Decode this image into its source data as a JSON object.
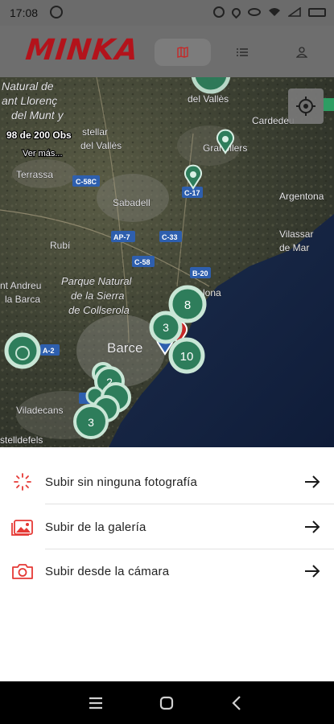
{
  "status_bar": {
    "time": "17:08",
    "icons": [
      "whatsapp-icon",
      "alarm-icon",
      "location-icon",
      "eye-icon",
      "wifi-icon",
      "signal-icon",
      "battery-icon"
    ]
  },
  "header": {
    "logo": "MINKA",
    "tabs": [
      {
        "icon": "map-icon",
        "active": true
      },
      {
        "icon": "list-icon",
        "active": false
      },
      {
        "icon": "profile-icon",
        "active": false
      }
    ]
  },
  "map": {
    "observations_count": "98 de 200 Obs",
    "see_more": "Ver más...",
    "labels": {
      "natural_park_title_1": "Natural de",
      "natural_park_title_2": "ant Llorenç",
      "natural_park_title_3": "del Munt y",
      "del_valles": "del Vallès",
      "cardedeu": "Cardedeu",
      "stellar": "stellar",
      "del_valles_2": "del Vallès",
      "granollers": "Granollers",
      "terrassa": "Terrassa",
      "sabadell": "Sabadell",
      "argentona": "Argentona",
      "vilassar": "Vilassar",
      "de_mar": "de Mar",
      "rubi": "Rubí",
      "collserola_1": "Parque Natural",
      "collserola_2": "de la Sierra",
      "collserola_3": "de Collserola",
      "andreu_1": "nt Andreu",
      "andreu_2": "la Barca",
      "badalona": "lona",
      "barcelona": "Barce",
      "viladecans": "Viladecans",
      "castelldefels": "stelldefels"
    },
    "roads": [
      "C-58C",
      "C-17",
      "AP-7",
      "C-33",
      "C-58",
      "B-20",
      "A-2",
      "C-32"
    ],
    "clusters": [
      "8",
      "3",
      "10",
      "2",
      "3"
    ],
    "accent": "#2e7d5b"
  },
  "sheet": {
    "options": [
      {
        "label": "Subir sin ninguna fotografía",
        "icon": "no-photo-icon"
      },
      {
        "label": "Subir de la galería",
        "icon": "gallery-icon"
      },
      {
        "label": "Subir desde la cámara",
        "icon": "camera-icon"
      }
    ],
    "accent": "#e53935"
  },
  "nav_bar": {
    "icons": [
      "recents-icon",
      "home-icon",
      "back-icon"
    ]
  }
}
